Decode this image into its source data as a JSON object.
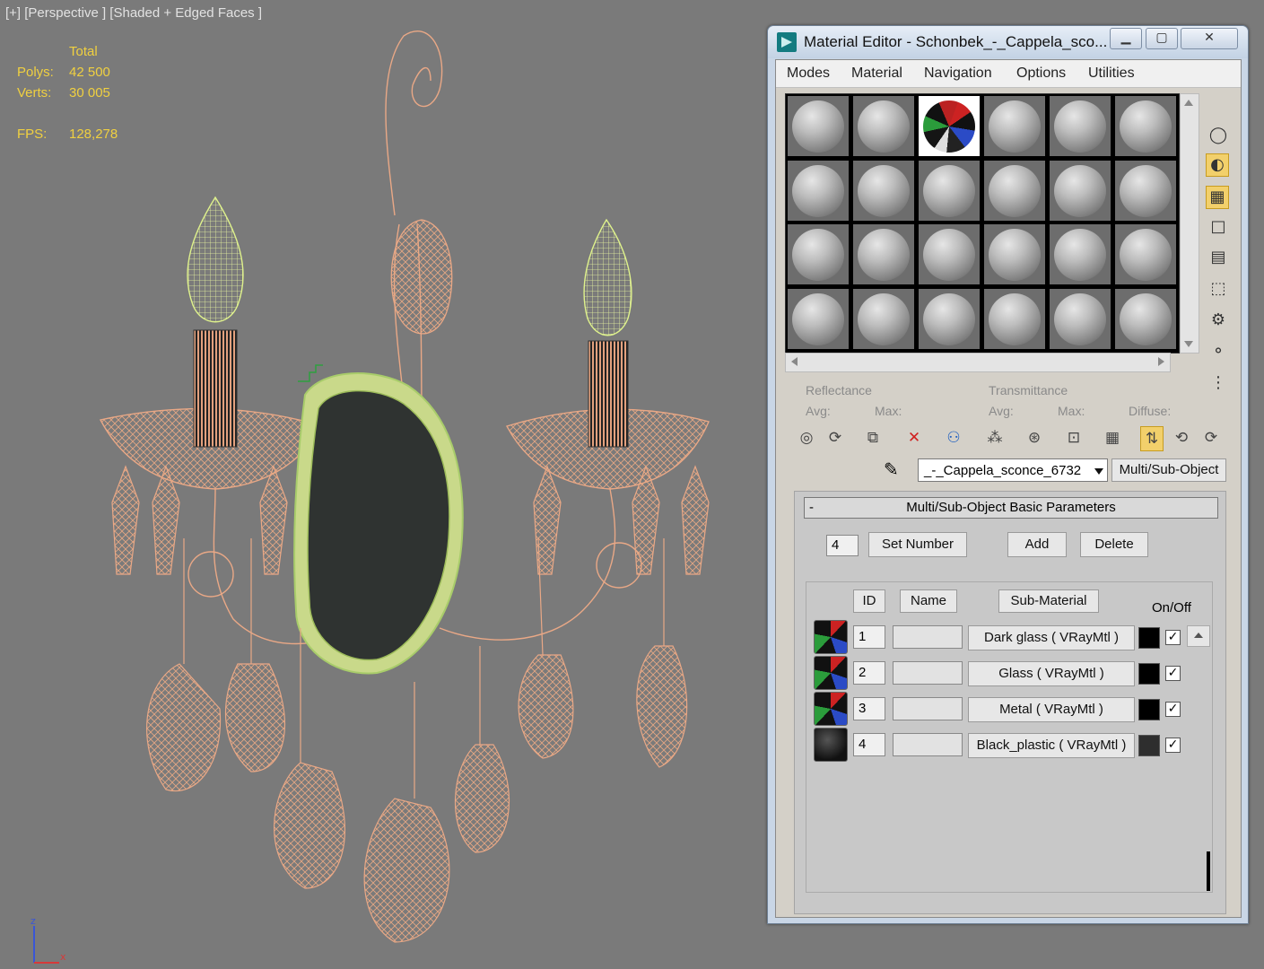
{
  "viewport": {
    "label": "[+] [Perspective ] [Shaded + Edged Faces ]",
    "stats": {
      "total_label": "Total",
      "polys_label": "Polys:",
      "polys_value": "42 500",
      "verts_label": "Verts:",
      "verts_value": "30 005",
      "fps_label": "FPS:",
      "fps_value": "128,278"
    },
    "axis": {
      "z": "z",
      "x": "x"
    }
  },
  "material_editor": {
    "title": "Material Editor - Schonbek_-_Cappela_sco...",
    "menu": [
      "Modes",
      "Material",
      "Navigation",
      "Options",
      "Utilities"
    ],
    "slot_grid": {
      "rows": 4,
      "cols": 6,
      "selected_index": 2
    },
    "reflectance_label": "Reflectance",
    "transmittance_label": "Transmittance",
    "avg_label": "Avg:",
    "max_label": "Max:",
    "diffuse_label": "Diffuse:",
    "material_name": "_-_Cappela_sconce_6732",
    "material_type": "Multi/Sub-Object",
    "rollout_title": "Multi/Sub-Object Basic Parameters",
    "rollout_toggle": "-",
    "count_value": "4",
    "set_number": "Set Number",
    "add": "Add",
    "delete": "Delete",
    "col_id": "ID",
    "col_name": "Name",
    "col_sub": "Sub-Material",
    "col_onoff": "On/Off",
    "rows": [
      {
        "id": "1",
        "name": "",
        "sub": "Dark glass  ( VRayMtl )",
        "color": "#000000",
        "on": "✓"
      },
      {
        "id": "2",
        "name": "",
        "sub": "Glass  ( VRayMtl )",
        "color": "#000000",
        "on": "✓"
      },
      {
        "id": "3",
        "name": "",
        "sub": "Metal  ( VRayMtl )",
        "color": "#000000",
        "on": "✓"
      },
      {
        "id": "4",
        "name": "",
        "sub": "Black_plastic  ( VRayMtl )",
        "color": "#2e2e2e",
        "on": "✓"
      }
    ]
  }
}
